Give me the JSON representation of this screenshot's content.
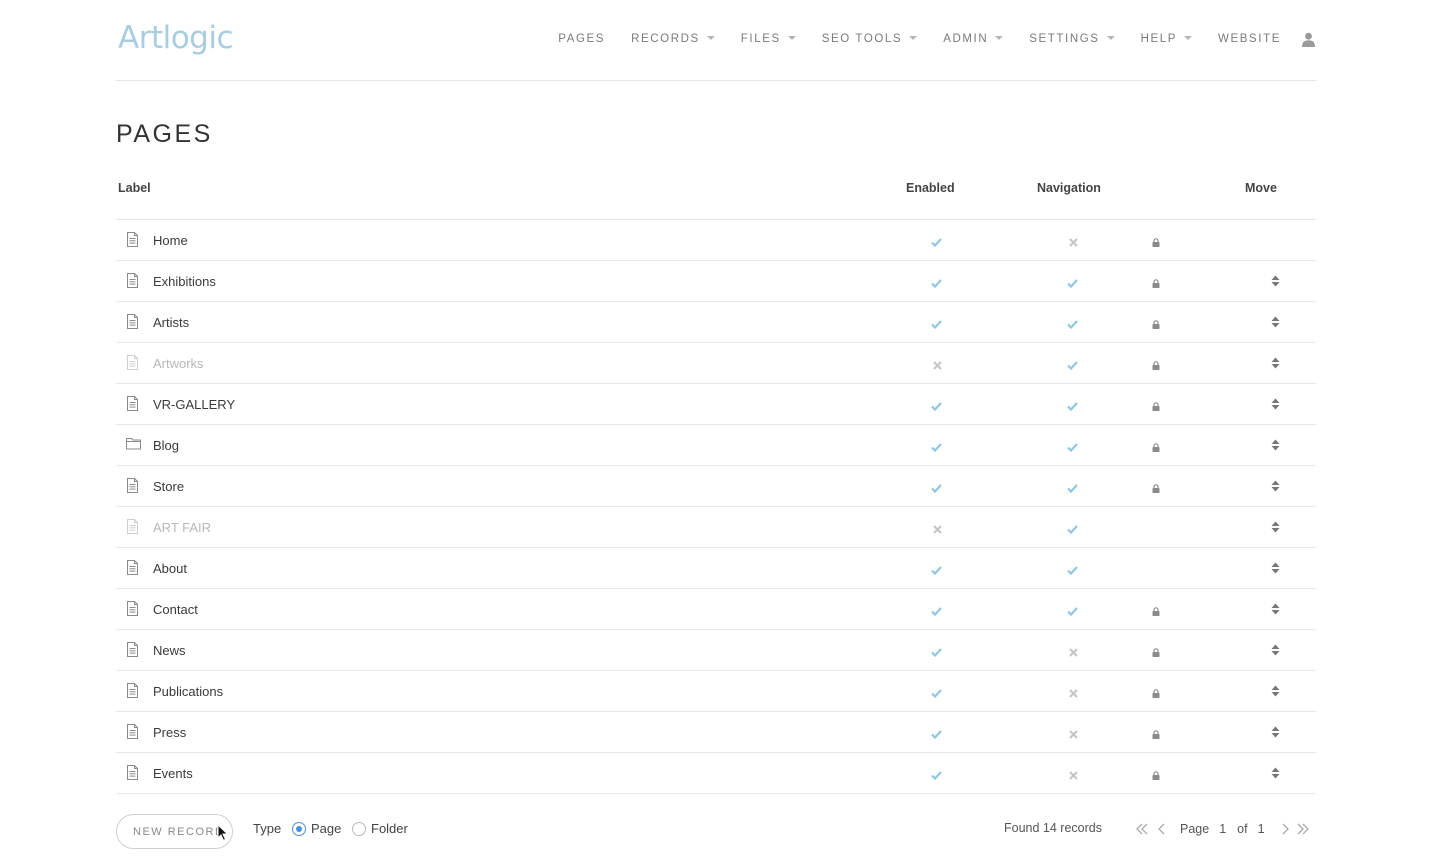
{
  "header": {
    "logo": "Artlogic",
    "nav": [
      {
        "label": "PAGES",
        "dropdown": false
      },
      {
        "label": "RECORDS",
        "dropdown": true
      },
      {
        "label": "FILES",
        "dropdown": true
      },
      {
        "label": "SEO TOOLS",
        "dropdown": true
      },
      {
        "label": "ADMIN",
        "dropdown": true
      },
      {
        "label": "SETTINGS",
        "dropdown": true
      },
      {
        "label": "HELP",
        "dropdown": true
      },
      {
        "label": "WEBSITE",
        "dropdown": false
      }
    ]
  },
  "page_title": "PAGES",
  "table": {
    "columns": {
      "label": "Label",
      "enabled": "Enabled",
      "navigation": "Navigation",
      "move": "Move"
    },
    "rows": [
      {
        "label": "Home",
        "type": "page",
        "enabled": true,
        "navigation": false,
        "locked": true,
        "movable": false
      },
      {
        "label": "Exhibitions",
        "type": "page",
        "enabled": true,
        "navigation": true,
        "locked": true,
        "movable": true
      },
      {
        "label": "Artists",
        "type": "page",
        "enabled": true,
        "navigation": true,
        "locked": true,
        "movable": true
      },
      {
        "label": "Artworks",
        "type": "page",
        "enabled": false,
        "navigation": true,
        "locked": true,
        "movable": true
      },
      {
        "label": "VR-GALLERY",
        "type": "page",
        "enabled": true,
        "navigation": true,
        "locked": true,
        "movable": true
      },
      {
        "label": "Blog",
        "type": "folder",
        "enabled": true,
        "navigation": true,
        "locked": true,
        "movable": true
      },
      {
        "label": "Store",
        "type": "page",
        "enabled": true,
        "navigation": true,
        "locked": true,
        "movable": true
      },
      {
        "label": "ART FAIR",
        "type": "page",
        "enabled": false,
        "navigation": true,
        "locked": false,
        "movable": true
      },
      {
        "label": "About",
        "type": "page",
        "enabled": true,
        "navigation": true,
        "locked": false,
        "movable": true
      },
      {
        "label": "Contact",
        "type": "page",
        "enabled": true,
        "navigation": true,
        "locked": true,
        "movable": true
      },
      {
        "label": "News",
        "type": "page",
        "enabled": true,
        "navigation": false,
        "locked": true,
        "movable": true
      },
      {
        "label": "Publications",
        "type": "page",
        "enabled": true,
        "navigation": false,
        "locked": true,
        "movable": true
      },
      {
        "label": "Press",
        "type": "page",
        "enabled": true,
        "navigation": false,
        "locked": true,
        "movable": true
      },
      {
        "label": "Events",
        "type": "page",
        "enabled": true,
        "navigation": false,
        "locked": true,
        "movable": true
      }
    ]
  },
  "footer": {
    "new_record_label": "NEW RECORD",
    "type_label": "Type",
    "type_options": [
      "Page",
      "Folder"
    ],
    "type_selected": "Page",
    "found_text": "Found 14 records",
    "pager": {
      "page_label": "Page",
      "current": "1",
      "of_label": "of",
      "total": "1"
    }
  },
  "colors": {
    "check": "#8fc7e3",
    "cross": "#c4c4c4",
    "lock": "#8a8a8a",
    "radio_accent": "#4a90e2",
    "logo": "#a9cde0"
  }
}
